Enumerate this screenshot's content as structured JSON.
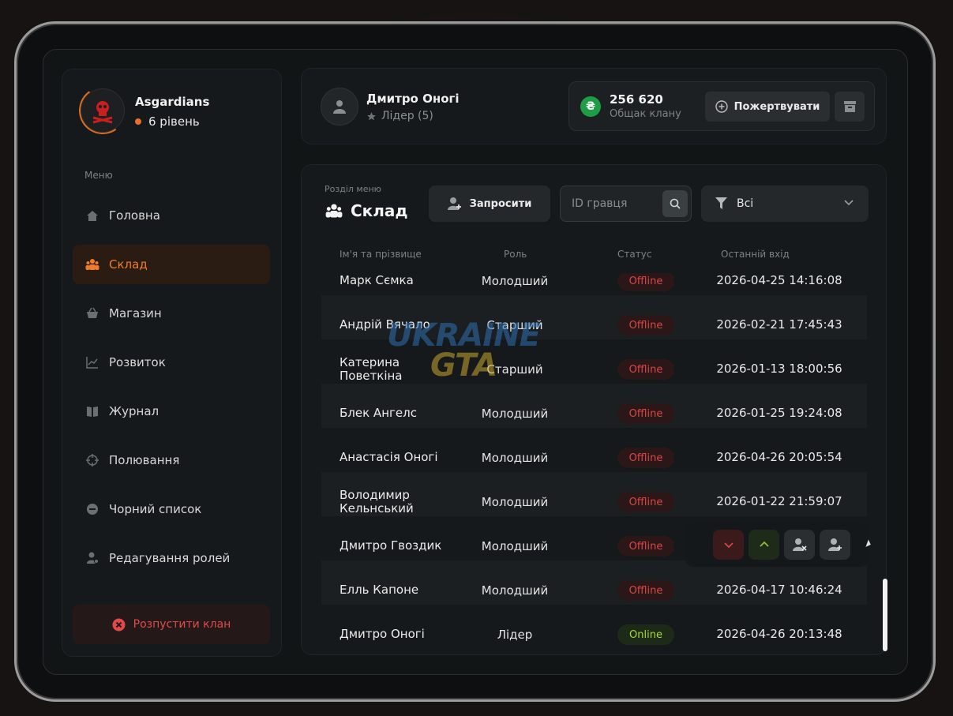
{
  "clan": {
    "name": "Asgardians",
    "level": "6 рівень"
  },
  "sidebar": {
    "caption": "Меню",
    "items": [
      {
        "label": "Головна",
        "icon": "home-icon"
      },
      {
        "label": "Склад",
        "icon": "people-icon"
      },
      {
        "label": "Магазин",
        "icon": "basket-icon"
      },
      {
        "label": "Розвиток",
        "icon": "chart-icon"
      },
      {
        "label": "Журнал",
        "icon": "book-icon"
      },
      {
        "label": "Полювання",
        "icon": "crosshair-icon"
      },
      {
        "label": "Чорний список",
        "icon": "block-icon"
      },
      {
        "label": "Редагування ролей",
        "icon": "user-gear-icon"
      }
    ],
    "active_index": 1,
    "disband_label": "Розпустити клан"
  },
  "header": {
    "leader_name": "Дмитро Оногі",
    "leader_role": "Лідер (5)",
    "money_amount": "256 620",
    "money_label": "Общак клану",
    "money_symbol": "₴",
    "donate_label": "Пожертвувати"
  },
  "main": {
    "section_caption": "Розділ меню",
    "section_title": "Склад",
    "invite_label": "Запросити",
    "search_placeholder": "ID гравця",
    "filter_value": "Всі",
    "columns": [
      "Ім'я та прізвище",
      "Роль",
      "Статус",
      "Останній вхід"
    ],
    "rows": [
      {
        "name": "Марк Сємка",
        "role": "Молодший",
        "status": "Offline",
        "last_login": "2026-04-25 14:16:08"
      },
      {
        "name": "Андрій Вячало",
        "role": "Старший",
        "status": "Offline",
        "last_login": "2026-02-21 17:45:43"
      },
      {
        "name": "Катерина Поветкіна",
        "role": "Старший",
        "status": "Offline",
        "last_login": "2026-01-13 18:00:56"
      },
      {
        "name": "Блек Ангелс",
        "role": "Молодший",
        "status": "Offline",
        "last_login": "2026-01-25 19:24:08"
      },
      {
        "name": "Анастасія Оногі",
        "role": "Молодший",
        "status": "Offline",
        "last_login": "2026-04-26 20:05:54"
      },
      {
        "name": "Володимир Кельнський",
        "role": "Молодший",
        "status": "Offline",
        "last_login": "2026-01-22 21:59:07"
      },
      {
        "name": "Дмитро Гвоздик",
        "role": "Молодший",
        "status": "Offline",
        "last_login": ""
      },
      {
        "name": "Елль Капоне",
        "role": "Молодший",
        "status": "Offline",
        "last_login": "2026-04-17 10:46:24"
      },
      {
        "name": "Дмитро Оногі",
        "role": "Лідер",
        "status": "Online",
        "last_login": "2026-04-26 20:13:48"
      }
    ]
  },
  "watermark": {
    "line1": "UKRAINE",
    "line2": "GTA"
  },
  "colors": {
    "accent": "#ef7a2a",
    "offline": "#d74747",
    "online": "#a6d83c",
    "money": "#1e9c46"
  }
}
